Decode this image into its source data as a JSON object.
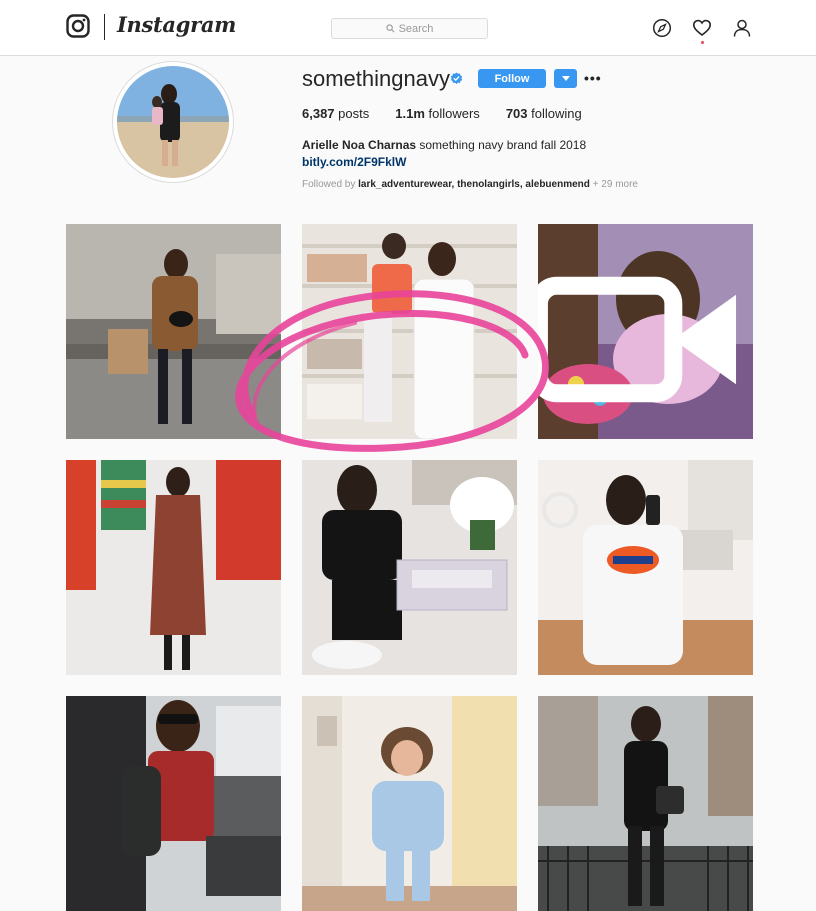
{
  "header": {
    "brand": "Instagram",
    "search_placeholder": "Search"
  },
  "profile": {
    "username": "somethingnavy",
    "follow_label": "Follow",
    "more_label": "•••",
    "stats": [
      {
        "value": "6,387",
        "label": "posts"
      },
      {
        "value": "1.1m",
        "label": "followers"
      },
      {
        "value": "703",
        "label": "following"
      }
    ],
    "bio_name": "Arielle Noa Charnas",
    "bio_text": " something navy brand fall 2018",
    "bio_link": "bitly.com/2F9FklW",
    "followed_by_prefix": "Followed by ",
    "followed_by_users": "lark_adventurewear, thenolangirls, alebuenmend",
    "followed_by_more": " + 29 more"
  },
  "colors": {
    "accent": "#3897f0",
    "verified": "#3897f0",
    "annotation": "#e8449a",
    "notification": "#ed4956"
  },
  "icons": [
    "instagram-glyph-icon",
    "search-icon",
    "explore-compass-icon",
    "heart-icon",
    "profile-icon",
    "verified-badge-icon",
    "chevron-down-icon",
    "video-camera-icon"
  ],
  "posts": [
    {
      "kind": "photo"
    },
    {
      "kind": "photo"
    },
    {
      "kind": "video"
    },
    {
      "kind": "photo"
    },
    {
      "kind": "photo"
    },
    {
      "kind": "photo"
    },
    {
      "kind": "photo"
    },
    {
      "kind": "photo"
    },
    {
      "kind": "photo"
    }
  ]
}
